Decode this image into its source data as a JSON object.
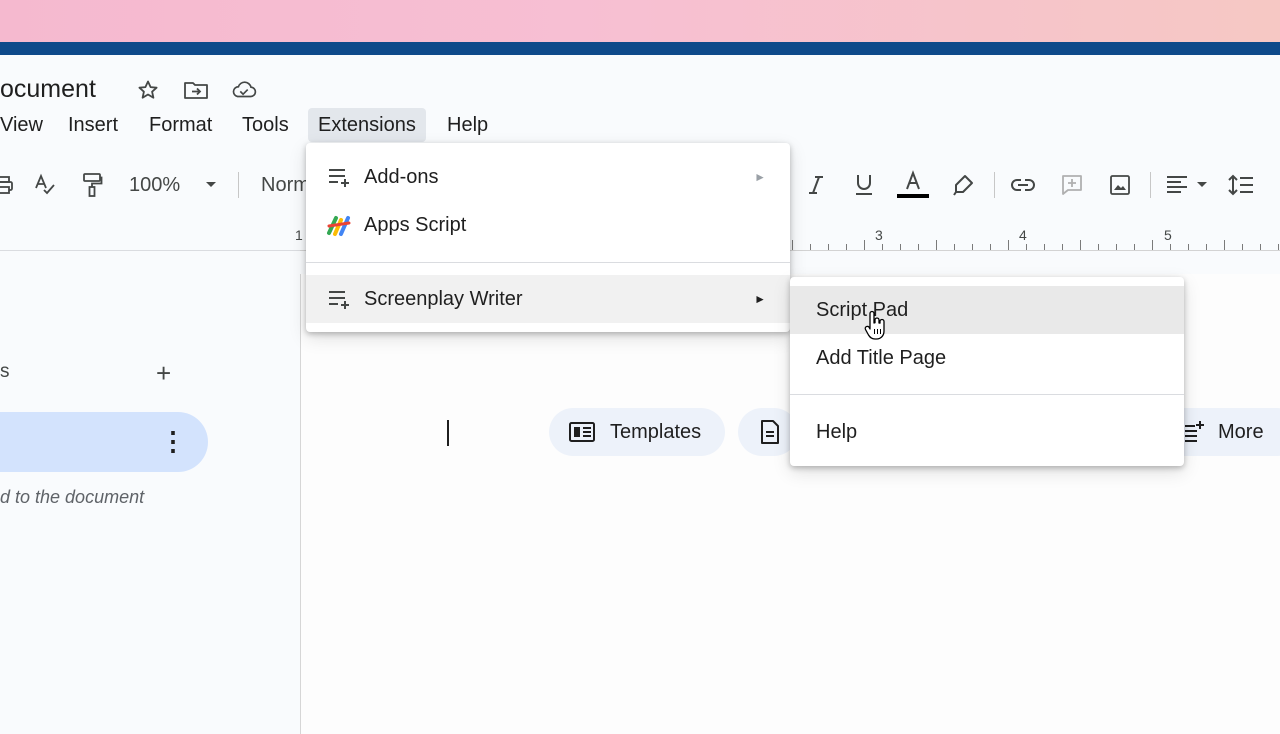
{
  "document": {
    "title": "ocument",
    "icons": [
      "star-icon",
      "move-folder-icon",
      "cloud-status-icon"
    ]
  },
  "menubar": {
    "items": [
      "View",
      "Insert",
      "Format",
      "Tools",
      "Extensions",
      "Help"
    ],
    "active": "Extensions"
  },
  "toolbar": {
    "zoom": "100%",
    "style_partial": "Norm",
    "text_color": "#000000",
    "icons": [
      "print-icon",
      "spellcheck-icon",
      "paint-format-icon",
      "italic-icon",
      "underline-icon",
      "text-color-icon",
      "highlight-icon",
      "link-icon",
      "comment-icon",
      "image-icon",
      "align-left-icon",
      "line-spacing-icon"
    ]
  },
  "ruler": {
    "numbers": [
      "1",
      "3",
      "4",
      "5"
    ]
  },
  "sidebar": {
    "section_label_partial": "s",
    "hint_partial": "d to the document",
    "tab_color": "#d3e3fd"
  },
  "chips": {
    "templates": "Templates",
    "more": "More"
  },
  "extensions_menu": {
    "items": [
      {
        "label": "Add-ons",
        "icon": "add-ons-icon",
        "has_submenu": true
      },
      {
        "label": "Apps Script",
        "icon": "apps-script-icon",
        "has_submenu": false
      },
      {
        "label": "Screenplay Writer",
        "icon": "add-on-list-icon",
        "has_submenu": true,
        "highlighted": true
      }
    ],
    "submenu_arrow": "►"
  },
  "screenplay_submenu": {
    "items": [
      "Script Pad",
      "Add Title Page",
      "Help"
    ],
    "hovered": "Script Pad"
  },
  "colors": {
    "accent_blue": "#0e4a8a",
    "tab_highlight": "#d3e3fd",
    "menu_hover": "#f1f1f1"
  }
}
